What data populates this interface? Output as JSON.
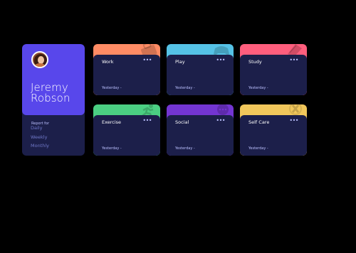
{
  "profile": {
    "report_for": "Report for",
    "name": "Jeremy Robson",
    "nav": [
      "Daily",
      "Weekly",
      "Monthly"
    ]
  },
  "activities": [
    {
      "title": "Work",
      "menu": "•••",
      "previous": "Yesterday -",
      "color": "#ff8b64",
      "icon": "briefcase-icon"
    },
    {
      "title": "Play",
      "menu": "•••",
      "previous": "Yesterday -",
      "color": "#55c2e6",
      "icon": "gamepad-icon"
    },
    {
      "title": "Study",
      "menu": "•••",
      "previous": "Yesterday -",
      "color": "#ff5e7d",
      "icon": "book-icon"
    },
    {
      "title": "Exercise",
      "menu": "•••",
      "previous": "Yesterday -",
      "color": "#4bcf82",
      "icon": "running-icon"
    },
    {
      "title": "Social",
      "menu": "•••",
      "previous": "Yesterday -",
      "color": "#7335d2",
      "icon": "chat-icon"
    },
    {
      "title": "Self Care",
      "menu": "•••",
      "previous": "Yesterday -",
      "color": "#f1c75b",
      "icon": "care-icon"
    }
  ]
}
